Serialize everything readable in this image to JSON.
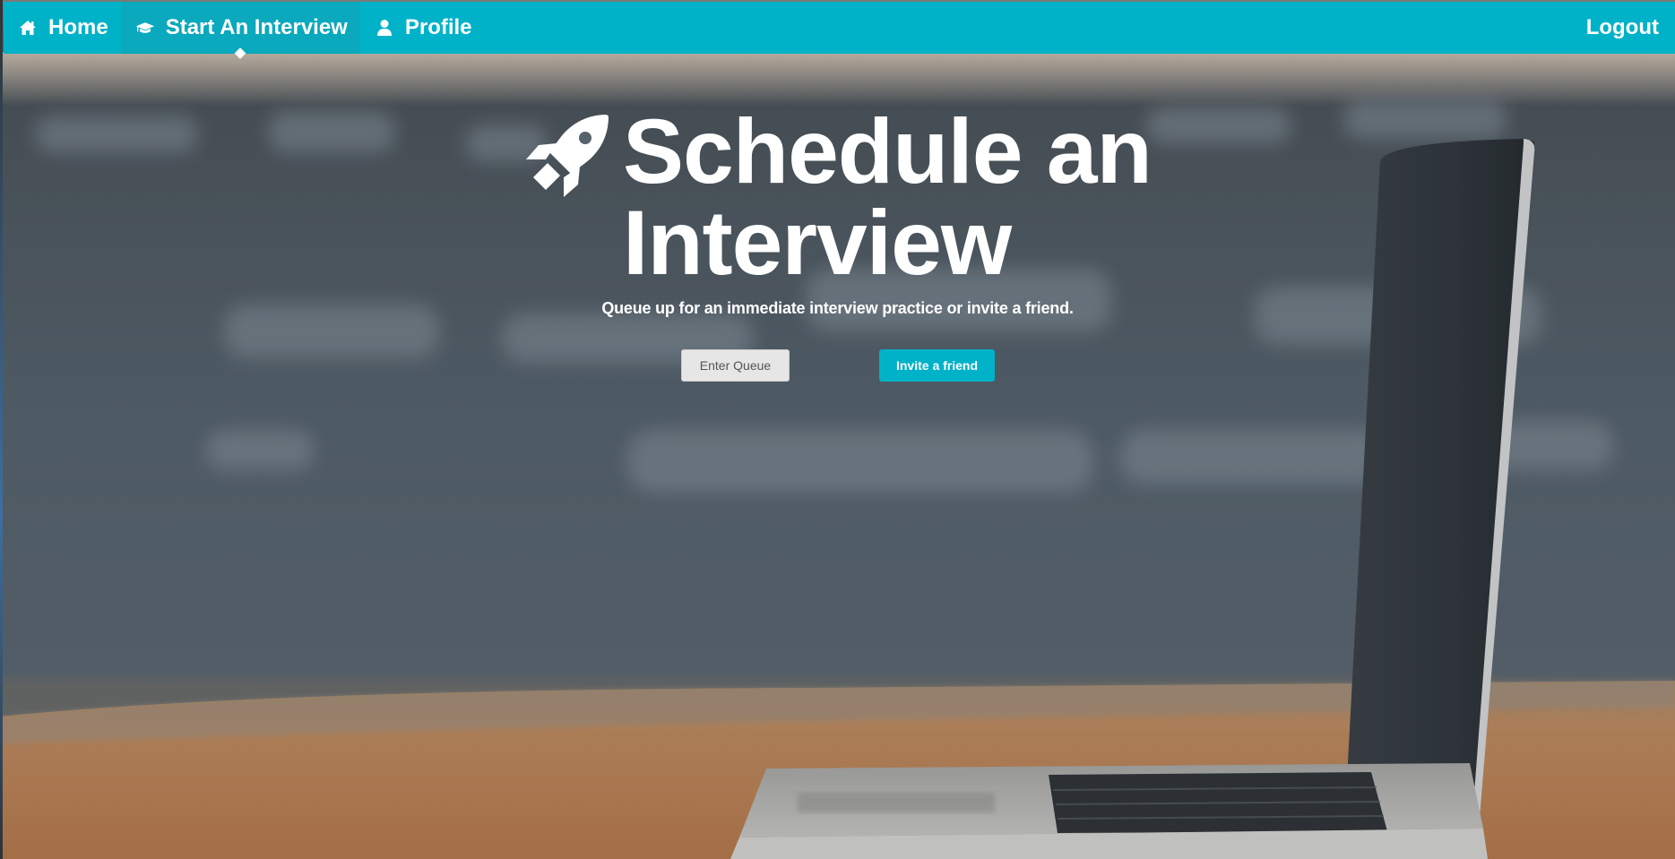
{
  "nav": {
    "home_label": "Home",
    "start_label": "Start An Interview",
    "profile_label": "Profile",
    "logout_label": "Logout",
    "home_icon": "home-icon",
    "start_icon": "graduation-cap-icon",
    "profile_icon": "user-icon",
    "active_tab": "Start An Interview"
  },
  "hero": {
    "title": "Schedule an Interview",
    "icon": "rocket-icon",
    "subtitle": "Queue up for an immediate interview practice or invite a friend.",
    "enter_queue_label": "Enter Queue",
    "invite_label": "Invite a friend"
  },
  "colors": {
    "accent": "#00b2c8",
    "button_secondary": "#e6e6e6",
    "text_light": "#ffffff"
  }
}
